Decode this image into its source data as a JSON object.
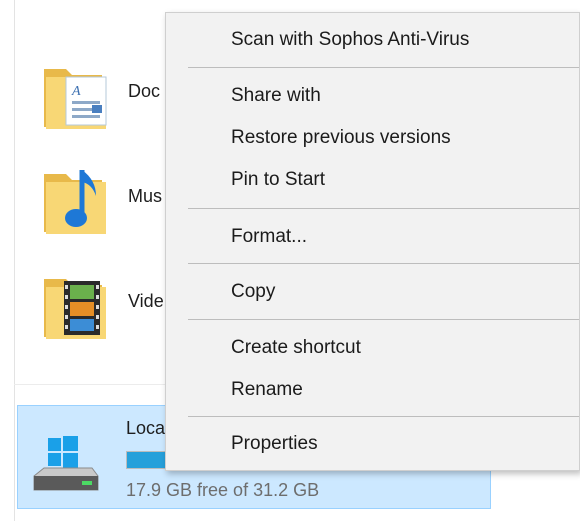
{
  "explorer": {
    "items": [
      {
        "label": "Doc",
        "icon": "documents-folder-icon"
      },
      {
        "label": "Mus",
        "icon": "music-folder-icon"
      },
      {
        "label": "Vide",
        "icon": "videos-folder-icon"
      }
    ],
    "drive": {
      "name": "Loca",
      "icon": "local-disk-icon",
      "used_fraction": 0.43,
      "free_text": "17.9 GB free of 31.2 GB"
    }
  },
  "context_menu": {
    "items": [
      {
        "label": "Scan with Sophos Anti-Virus"
      },
      {
        "label": "Share with"
      },
      {
        "label": "Restore previous versions"
      },
      {
        "label": "Pin to Start"
      },
      {
        "label": "Format..."
      },
      {
        "label": "Copy"
      },
      {
        "label": "Create shortcut"
      },
      {
        "label": "Rename"
      },
      {
        "label": "Properties"
      }
    ]
  },
  "colors": {
    "selection_bg": "#cce8ff",
    "drive_bar": "#26a0da",
    "menu_bg": "#f2f2f2"
  }
}
